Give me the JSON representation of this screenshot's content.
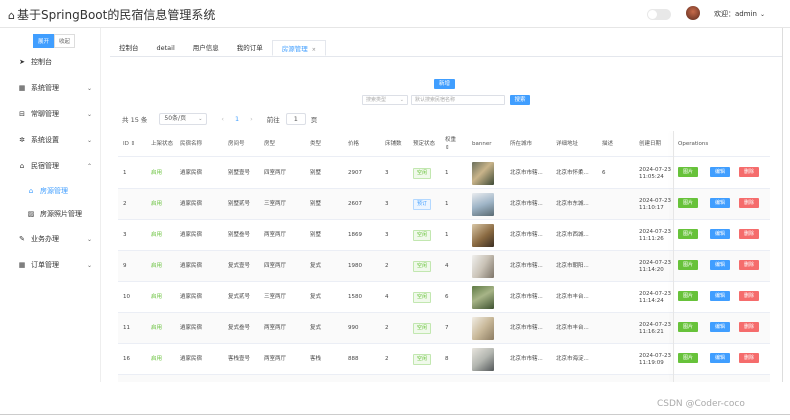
{
  "header": {
    "title": "基于SpringBoot的民宿信息管理系统",
    "home_icon": "⌂",
    "welcome": "欢迎：admin"
  },
  "sidebar": {
    "toggle_open": "展开",
    "toggle_close": "收起",
    "items": [
      {
        "label": "控制台",
        "icon": "send-icon",
        "glyph": "➤"
      },
      {
        "label": "系统管理",
        "icon": "grid-icon",
        "glyph": "▦"
      },
      {
        "label": "常聊管理",
        "icon": "inbox-icon",
        "glyph": "⊟"
      },
      {
        "label": "系统设置",
        "icon": "gear-icon",
        "glyph": "✲"
      },
      {
        "label": "民宿管理",
        "icon": "home-icon",
        "glyph": "⌂"
      },
      {
        "label": "房源管理",
        "icon": "home-icon",
        "glyph": "⌂"
      },
      {
        "label": "房源照片管理",
        "icon": "image-icon",
        "glyph": "▨"
      },
      {
        "label": "业务办理",
        "icon": "edit-icon",
        "glyph": "✎"
      },
      {
        "label": "订单管理",
        "icon": "calendar-icon",
        "glyph": "▦"
      }
    ]
  },
  "tabs": [
    {
      "label": "控制台"
    },
    {
      "label": "detail"
    },
    {
      "label": "用户信息"
    },
    {
      "label": "我的订单"
    },
    {
      "label": "房源管理",
      "close": "×"
    }
  ],
  "toolbar": {
    "add_label": "新增",
    "select_placeholder": "搜索类型",
    "search_placeholder": "默认搜索民宿名称",
    "search_label": "搜索"
  },
  "pager": {
    "total": "共 15 条",
    "page_size": "50条/页",
    "prev": "‹",
    "current": "1",
    "next": "›",
    "goto": "前往",
    "page_input": "1",
    "page_unit": "页"
  },
  "table": {
    "headers": [
      "ID",
      "上架状态",
      "民宿名称",
      "房间号",
      "房型",
      "类型",
      "价格",
      "床铺数",
      "预定状态",
      "权重",
      "banner",
      "所在城市",
      "详细地址",
      "描述",
      "创建日期",
      "Operations"
    ],
    "sort_marks": [
      "⇕",
      "⇕"
    ],
    "buttons": {
      "photo": "图片",
      "edit": "编辑",
      "delete": "删除"
    },
    "rows": [
      {
        "id": "1",
        "status": "启用",
        "name": "逍家民宿",
        "room": "别墅壹号",
        "room_type": "四室两厅",
        "type": "别墅",
        "price": "2907",
        "beds": "3",
        "book": "空闲",
        "book_style": "g",
        "weight": "1",
        "city": "北京市市辖...",
        "addr": "北京市怀柔...",
        "desc": "6",
        "date": "2024-07-23",
        "time": "11:05:24",
        "img": "thumb-a"
      },
      {
        "id": "2",
        "status": "启用",
        "name": "逍家民宿",
        "room": "别墅贰号",
        "room_type": "三室两厅",
        "type": "别墅",
        "price": "2607",
        "beds": "3",
        "book": "预订",
        "book_style": "b",
        "weight": "1",
        "city": "北京市市辖...",
        "addr": "北京市东城...",
        "desc": "",
        "date": "2024-07-23",
        "time": "11:10:17",
        "img": "thumb-b"
      },
      {
        "id": "3",
        "status": "启用",
        "name": "逍家民宿",
        "room": "别墅叁号",
        "room_type": "两室两厅",
        "type": "别墅",
        "price": "1869",
        "beds": "3",
        "book": "空闲",
        "book_style": "g",
        "weight": "1",
        "city": "北京市市辖...",
        "addr": "北京市西城...",
        "desc": "",
        "date": "2024-07-23",
        "time": "11:11:26",
        "img": "thumb-c"
      },
      {
        "id": "9",
        "status": "启用",
        "name": "逍家民宿",
        "room": "复式壹号",
        "room_type": "四室两厅",
        "type": "复式",
        "price": "1980",
        "beds": "2",
        "book": "空闲",
        "book_style": "g",
        "weight": "4",
        "city": "北京市市辖...",
        "addr": "北京市朝阳...",
        "desc": "",
        "date": "2024-07-23",
        "time": "11:14:20",
        "img": "thumb-d"
      },
      {
        "id": "10",
        "status": "启用",
        "name": "逍家民宿",
        "room": "复式贰号",
        "room_type": "三室两厅",
        "type": "复式",
        "price": "1580",
        "beds": "4",
        "book": "空闲",
        "book_style": "g",
        "weight": "6",
        "city": "北京市市辖...",
        "addr": "北京市丰台...",
        "desc": "",
        "date": "2024-07-23",
        "time": "11:14:24",
        "img": "thumb-e"
      },
      {
        "id": "11",
        "status": "启用",
        "name": "逍家民宿",
        "room": "复式叁号",
        "room_type": "两室两厅",
        "type": "复式",
        "price": "990",
        "beds": "2",
        "book": "空闲",
        "book_style": "g",
        "weight": "7",
        "city": "北京市市辖...",
        "addr": "北京市丰台...",
        "desc": "",
        "date": "2024-07-23",
        "time": "11:16:21",
        "img": "thumb-f"
      },
      {
        "id": "16",
        "status": "启用",
        "name": "逍家民宿",
        "room": "客栈壹号",
        "room_type": "两室两厅",
        "type": "客栈",
        "price": "888",
        "beds": "2",
        "book": "空闲",
        "book_style": "g",
        "weight": "8",
        "city": "北京市市辖...",
        "addr": "北京市海淀...",
        "desc": "",
        "date": "2024-07-23",
        "time": "11:19:09",
        "img": "thumb-g"
      }
    ]
  },
  "watermark": "CSDN @Coder-coco",
  "colors": {
    "primary": "#409eff",
    "success": "#67c23a",
    "danger": "#f56c6c"
  }
}
